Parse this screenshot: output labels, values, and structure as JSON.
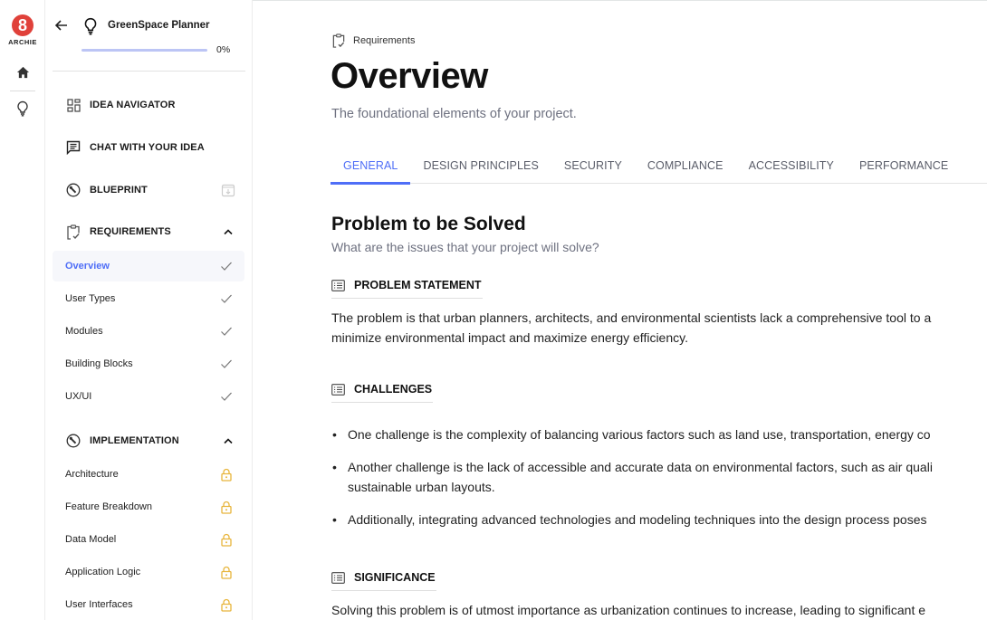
{
  "app": {
    "logo_mark": "8",
    "logo_text": "ARCHIE",
    "brand_color": "#e0413a",
    "accent_color": "#4f6ef7"
  },
  "rail": {
    "items": [
      {
        "icon": "home-icon"
      },
      {
        "icon": "lightbulb-icon"
      }
    ]
  },
  "sidebar": {
    "project_title": "GreenSpace Planner",
    "progress_percent": 0,
    "progress_label": "0%",
    "sections": [
      {
        "label": "IDEA NAVIGATOR",
        "icon": "dashboard-icon"
      },
      {
        "label": "CHAT WITH YOUR IDEA",
        "icon": "chat-icon"
      },
      {
        "label": "BLUEPRINT",
        "icon": "wrench-icon",
        "action_icon": "download-box-icon"
      },
      {
        "label": "REQUIREMENTS",
        "icon": "clipboard-check-icon",
        "expanded": true
      },
      {
        "label": "IMPLEMENTATION",
        "icon": "wrench-icon",
        "expanded": true
      }
    ],
    "requirements_items": [
      {
        "label": "Overview",
        "status": "check-icon",
        "active": true
      },
      {
        "label": "User Types",
        "status": "check-icon"
      },
      {
        "label": "Modules",
        "status": "check-icon"
      },
      {
        "label": "Building Blocks",
        "status": "check-icon"
      },
      {
        "label": "UX/UI",
        "status": "check-icon"
      }
    ],
    "implementation_items": [
      {
        "label": "Architecture",
        "status": "lock-icon"
      },
      {
        "label": "Feature Breakdown",
        "status": "lock-icon"
      },
      {
        "label": "Data Model",
        "status": "lock-icon"
      },
      {
        "label": "Application Logic",
        "status": "lock-icon"
      },
      {
        "label": "User Interfaces",
        "status": "lock-icon"
      }
    ],
    "lock_color": "#e8b53c"
  },
  "main": {
    "breadcrumb": "Requirements",
    "title": "Overview",
    "subtitle": "The foundational elements of your project.",
    "tabs": [
      {
        "label": "GENERAL",
        "active": true
      },
      {
        "label": "DESIGN PRINCIPLES"
      },
      {
        "label": "SECURITY"
      },
      {
        "label": "COMPLIANCE"
      },
      {
        "label": "ACCESSIBILITY"
      },
      {
        "label": "PERFORMANCE"
      }
    ],
    "section": {
      "title": "Problem to be Solved",
      "subtitle": "What are the issues that your project will solve?"
    },
    "problem_statement": {
      "label": "PROBLEM STATEMENT",
      "line1": "The problem is that urban planners, architects, and environmental scientists lack a comprehensive tool to a",
      "line2": "minimize environmental impact and maximize energy efficiency."
    },
    "challenges": {
      "label": "CHALLENGES",
      "items": [
        "One challenge is the complexity of balancing various factors such as land use, transportation, energy co",
        "Another challenge is the lack of accessible and accurate data on environmental factors, such as air quali\nsustainable urban layouts.",
        "Additionally, integrating advanced technologies and modeling techniques into the design process poses"
      ]
    },
    "significance": {
      "label": "SIGNIFICANCE",
      "line1": "Solving this problem is of utmost importance as urbanization continues to increase, leading to significant e"
    }
  }
}
